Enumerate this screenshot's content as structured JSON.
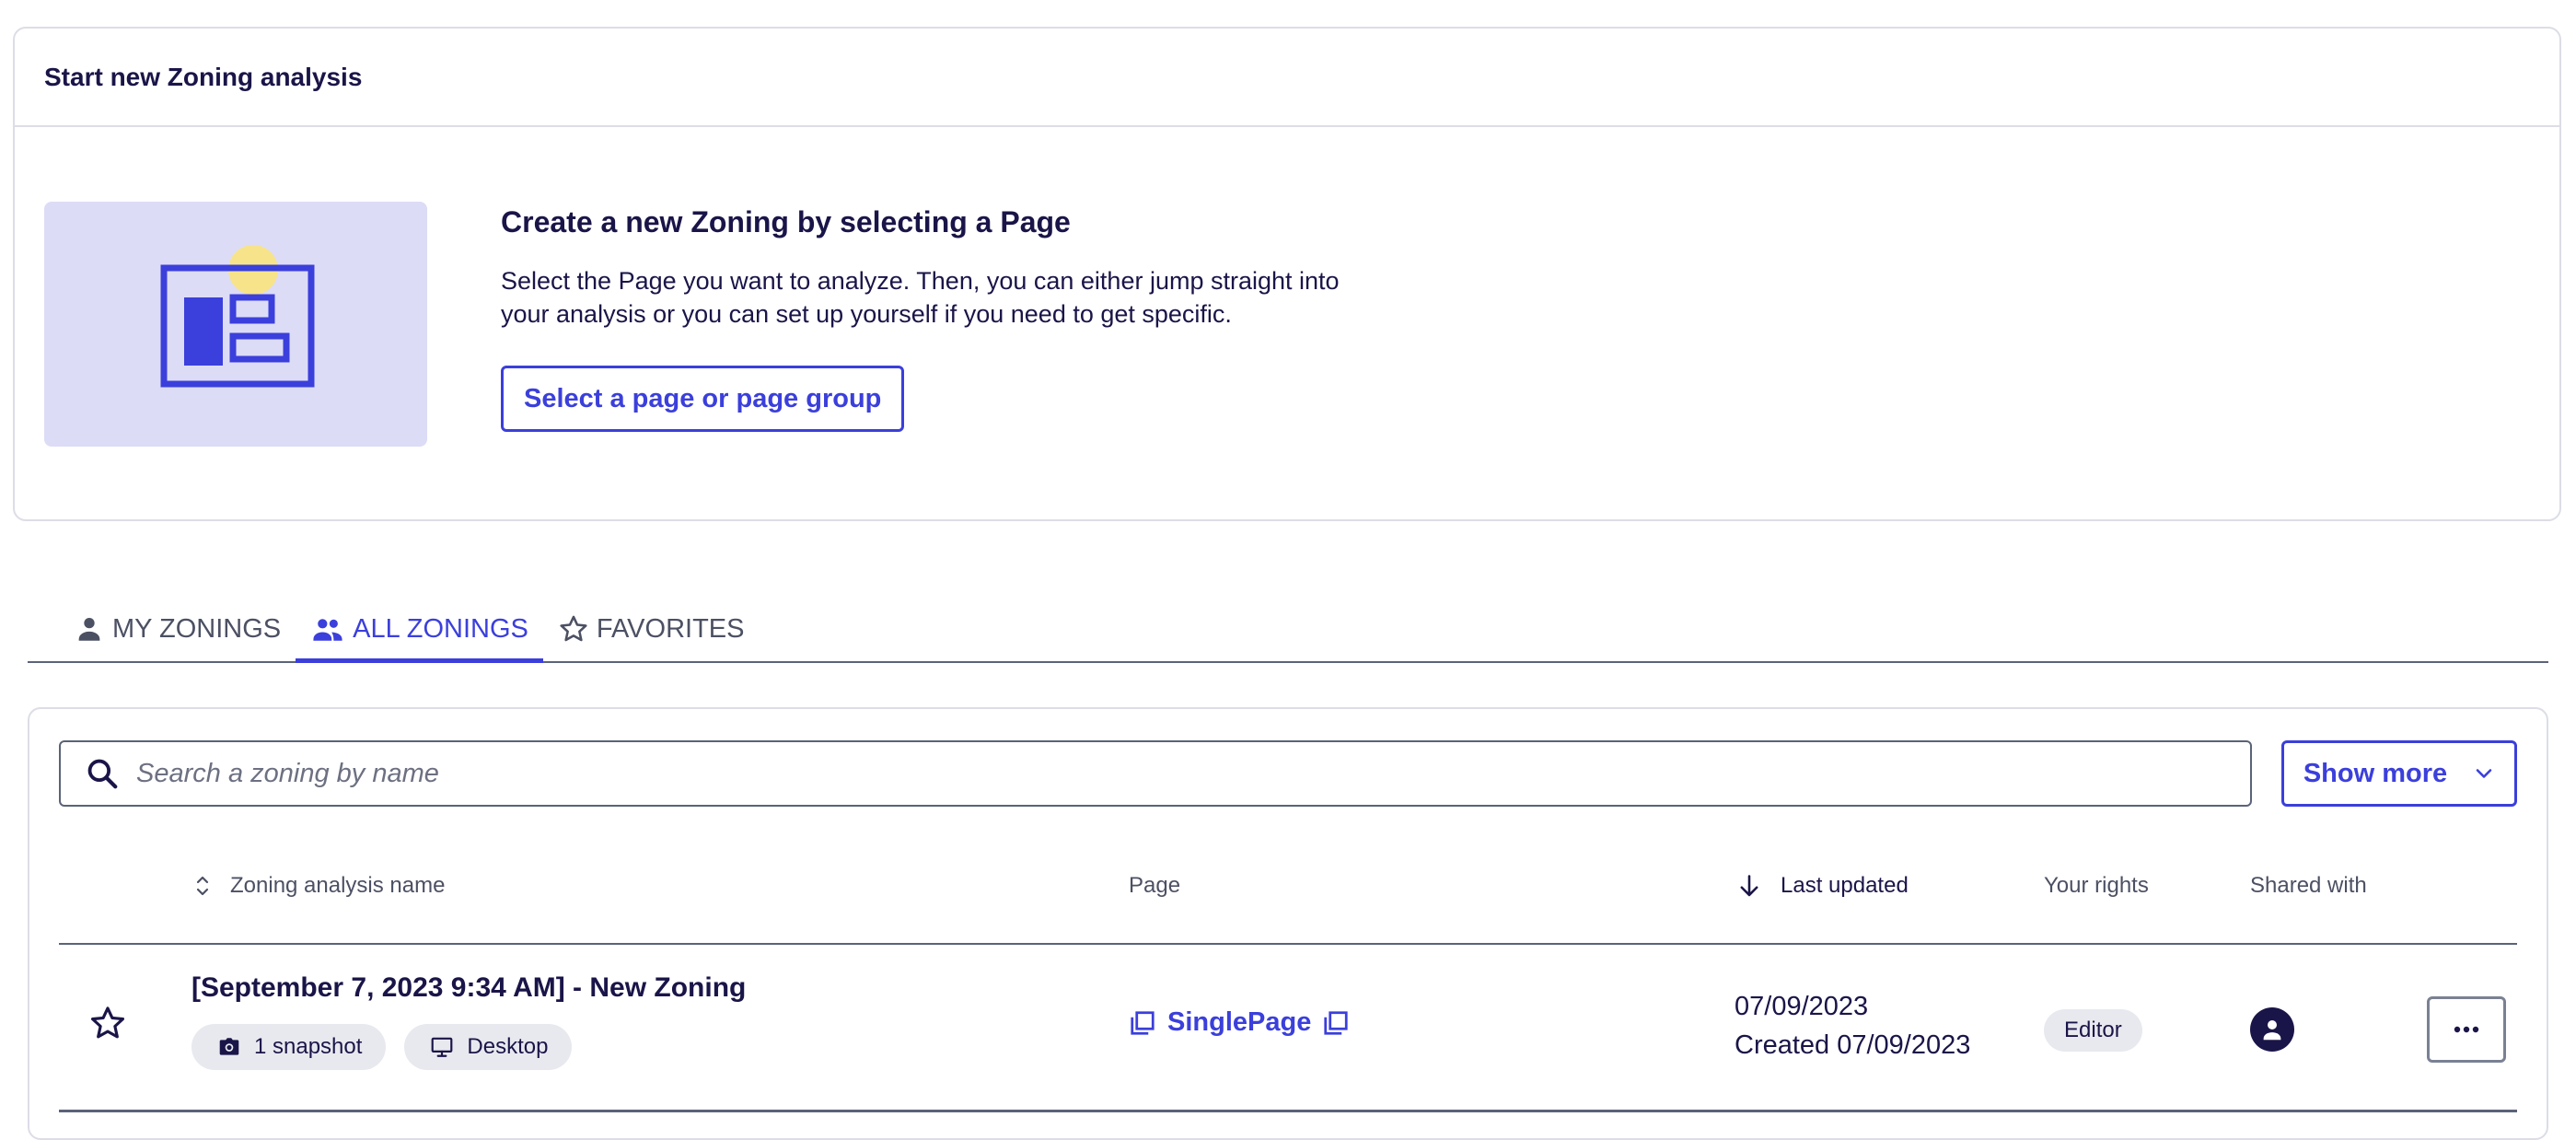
{
  "start_card": {
    "title": "Start new Zoning analysis",
    "intro_title": "Create a new Zoning by selecting a Page",
    "intro_desc": "Select the Page you want to analyze. Then, you can either jump straight into your analysis or you can set up yourself if you need to get specific.",
    "select_button": "Select a page or page group",
    "illustration_icon": "page-layout-illustration"
  },
  "tabs": [
    {
      "label": "MY ZONINGS",
      "icon": "person-icon",
      "active": false
    },
    {
      "label": "ALL ZONINGS",
      "icon": "people-icon",
      "active": true
    },
    {
      "label": "FAVORITES",
      "icon": "star-outline-icon",
      "active": false
    }
  ],
  "search": {
    "placeholder": "Search a zoning by name",
    "value": ""
  },
  "show_more_button": "Show more",
  "table": {
    "columns": {
      "name": "Zoning analysis name",
      "page": "Page",
      "last_updated": "Last updated",
      "rights": "Your rights",
      "shared": "Shared with"
    },
    "rows": [
      {
        "name": "[September 7, 2023 9:34 AM] - New Zoning",
        "snapshot": "1 snapshot",
        "device": "Desktop",
        "page": "SinglePage",
        "updated": "07/09/2023",
        "created": "Created 07/09/2023",
        "rights": "Editor"
      }
    ]
  },
  "colors": {
    "accent": "#3b3fdb",
    "text": "#1a1548",
    "illustration_bg": "#dcdcf7",
    "illustration_sun": "#f7e48a"
  }
}
